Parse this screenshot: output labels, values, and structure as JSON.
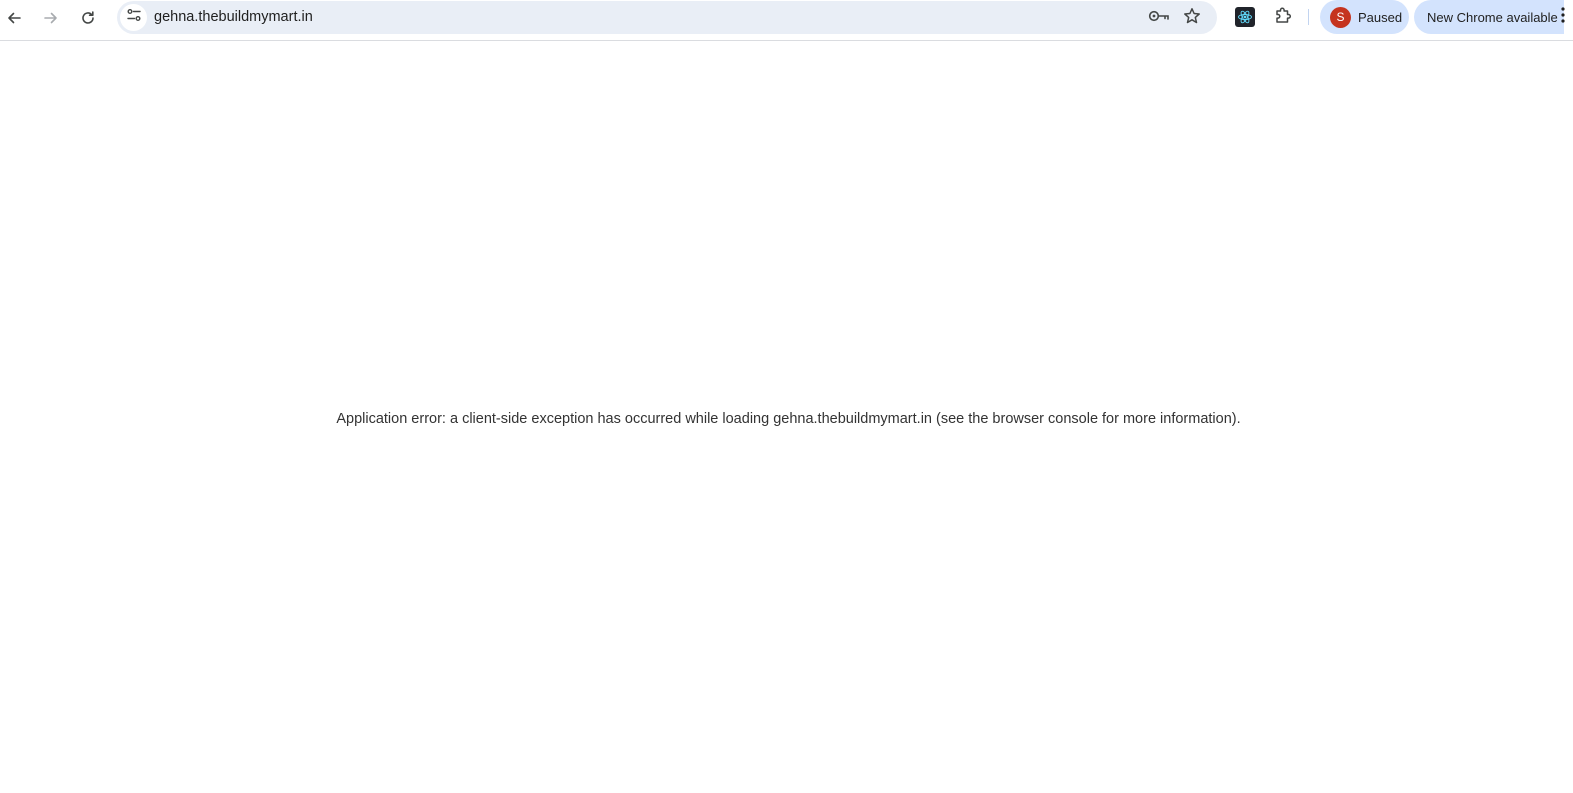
{
  "browser": {
    "url": "gehna.thebuildmymart.in",
    "icons": {
      "back": "arrow-left-icon",
      "forward": "arrow-right-icon",
      "reload": "reload-icon",
      "site_info": "tune-icon",
      "password": "key-icon",
      "bookmark": "star-icon",
      "react_devtools": "react-icon",
      "extensions": "puzzle-icon",
      "menu": "kebab-menu-icon"
    },
    "profile": {
      "initial": "S",
      "status": "Paused",
      "avatar_color": "#c5341f"
    },
    "update_label": "New Chrome available",
    "colors": {
      "omnibox_bg": "#e9eef6",
      "chip_bg": "#d3e3fd"
    }
  },
  "page": {
    "error_message": "Application error: a client-side exception has occurred while loading gehna.thebuildmymart.in (see the browser console for more information)."
  }
}
